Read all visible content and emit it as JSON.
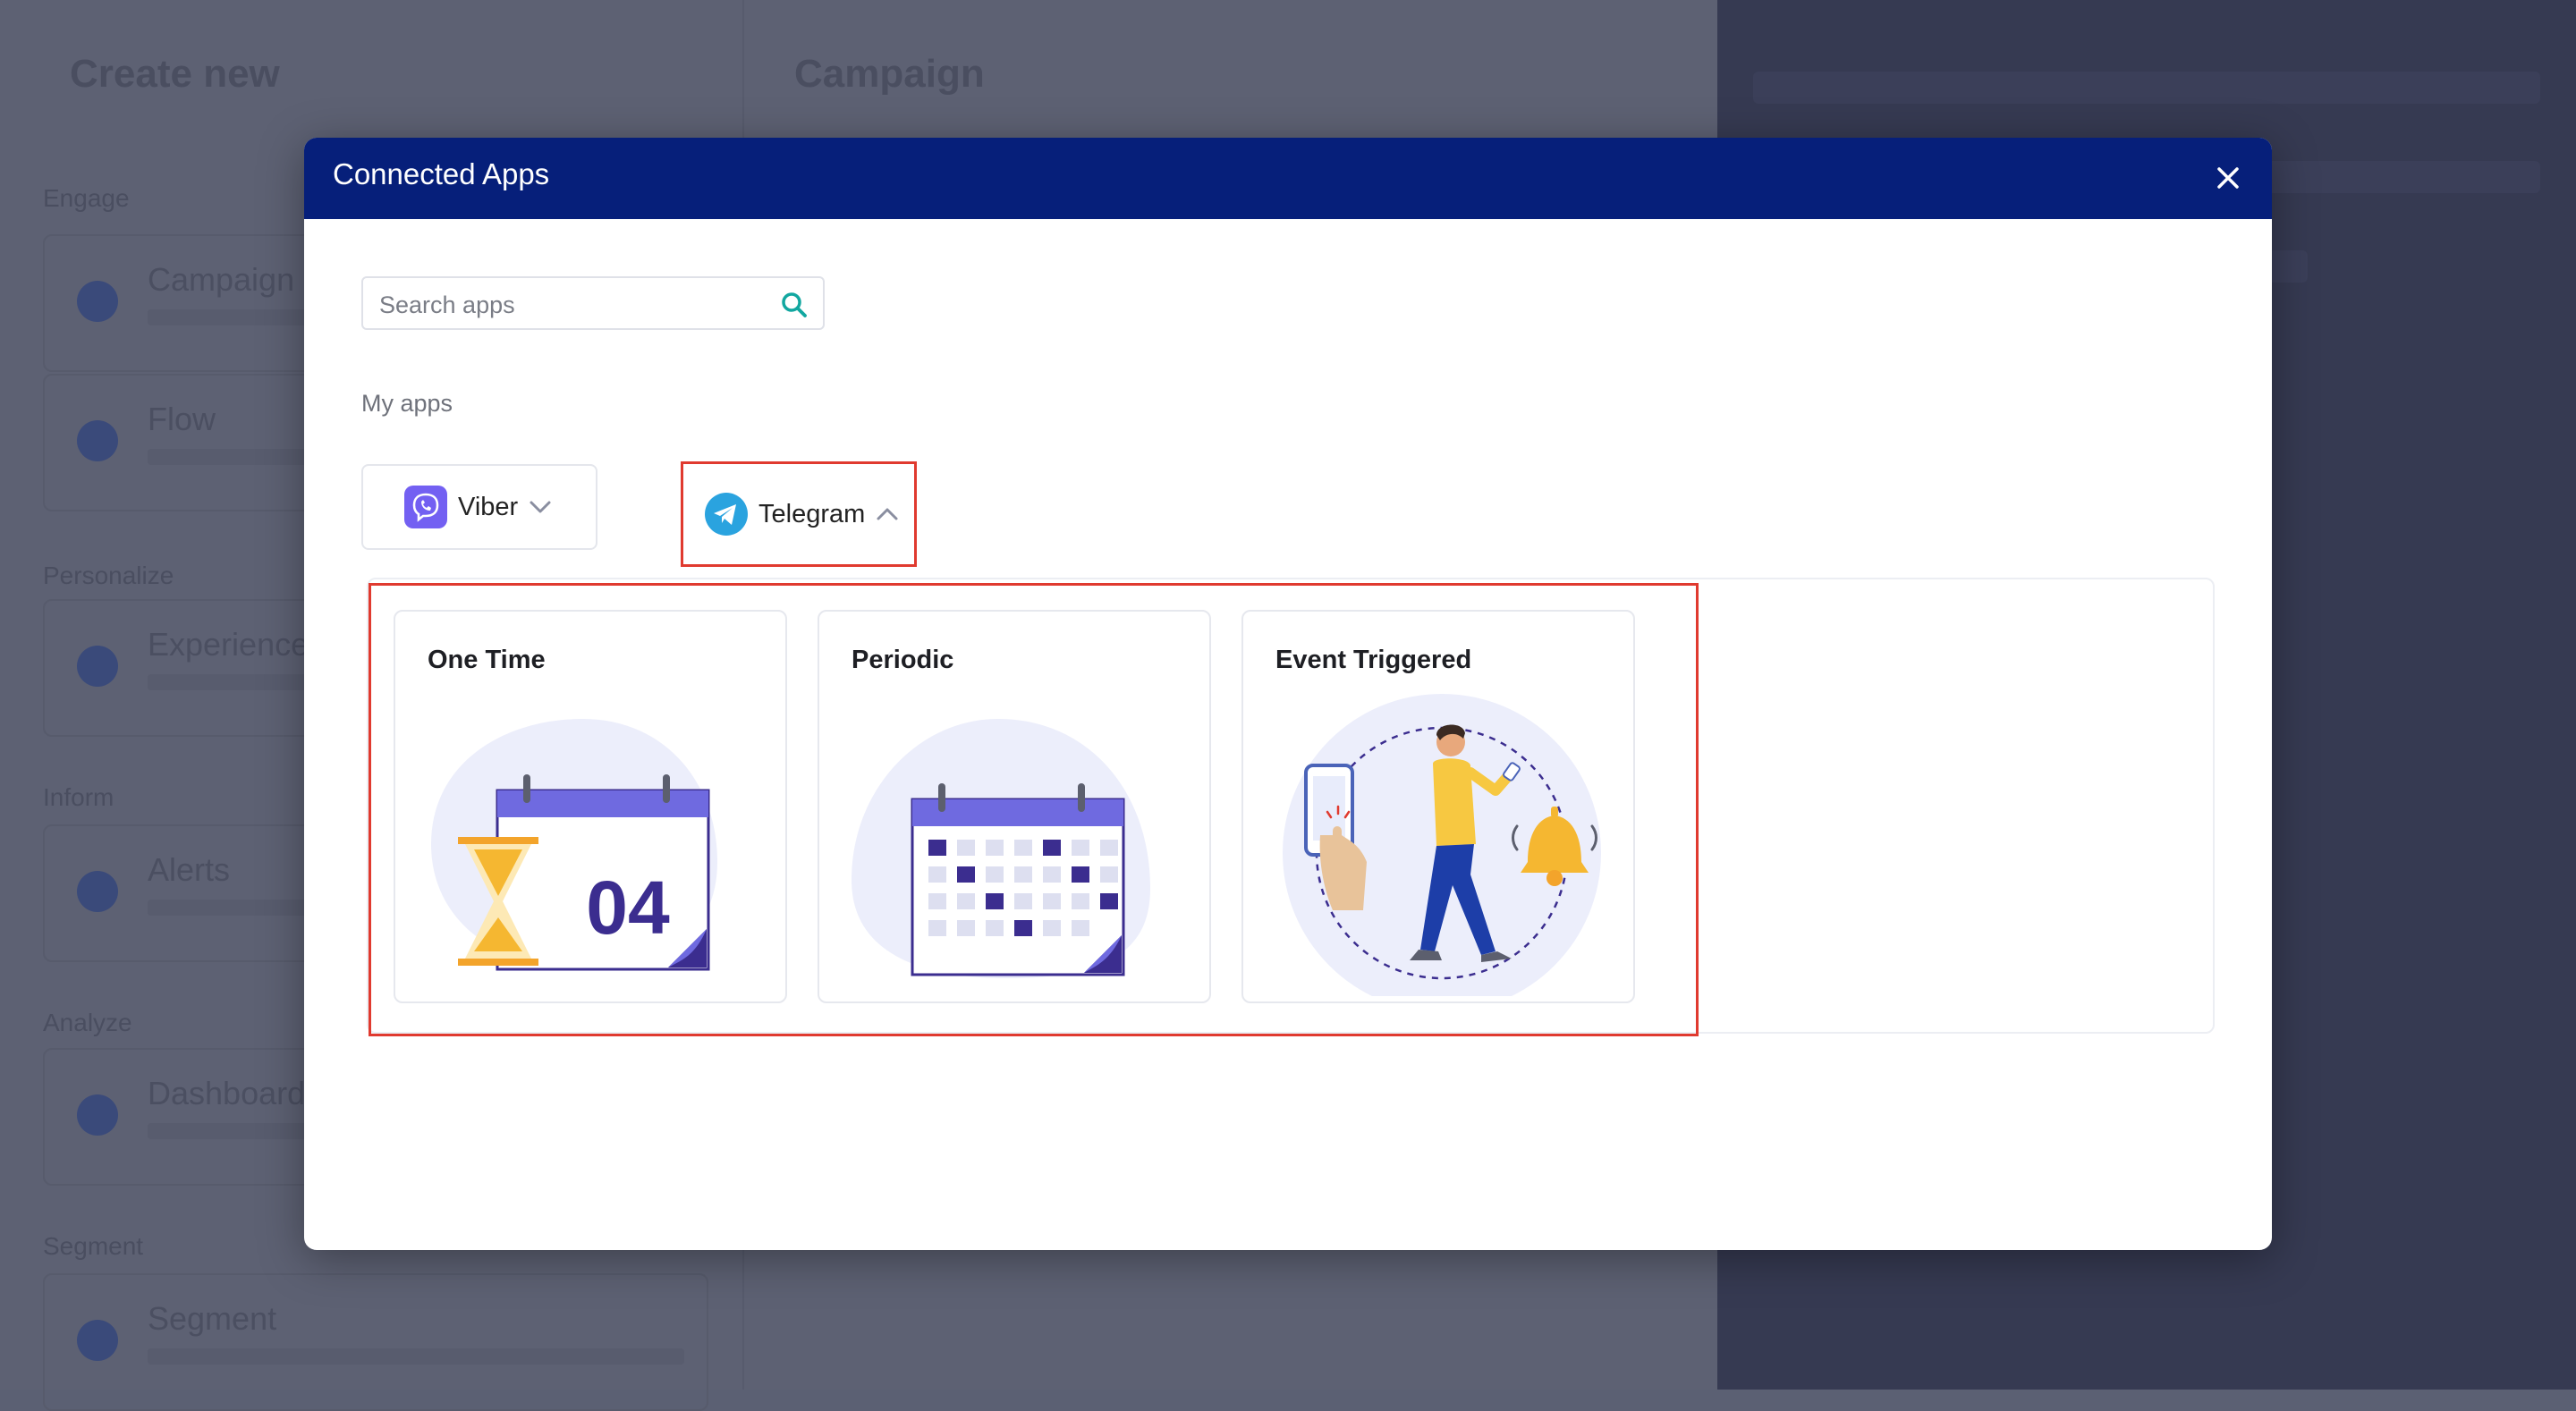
{
  "background": {
    "page_title": "Create new",
    "right_title": "Campaign",
    "sections": [
      "Engage",
      "Personalize",
      "Inform",
      "Analyze",
      "Segment"
    ],
    "items": [
      "Campaign",
      "Flow",
      "Experience",
      "Alerts",
      "Dashboard",
      "Segment"
    ]
  },
  "modal": {
    "title": "Connected Apps",
    "search": {
      "placeholder": "Search apps",
      "value": ""
    },
    "my_apps_label": "My apps",
    "apps": [
      {
        "label": "Viber",
        "icon": "viber-icon",
        "state": "collapsed"
      },
      {
        "label": "Telegram",
        "icon": "telegram-icon",
        "state": "expanded"
      }
    ],
    "campaign_types": [
      {
        "title": "One Time",
        "illustration": "calendar-hourglass-icon",
        "calendar_number": "04"
      },
      {
        "title": "Periodic",
        "illustration": "calendar-grid-icon"
      },
      {
        "title": "Event Triggered",
        "illustration": "person-phone-bell-icon"
      }
    ]
  },
  "colors": {
    "header": "#061f7a",
    "highlight": "#e03a2f",
    "accent": "#6f6ae0",
    "viber": "#7360f2",
    "telegram": "#2aa3df"
  }
}
